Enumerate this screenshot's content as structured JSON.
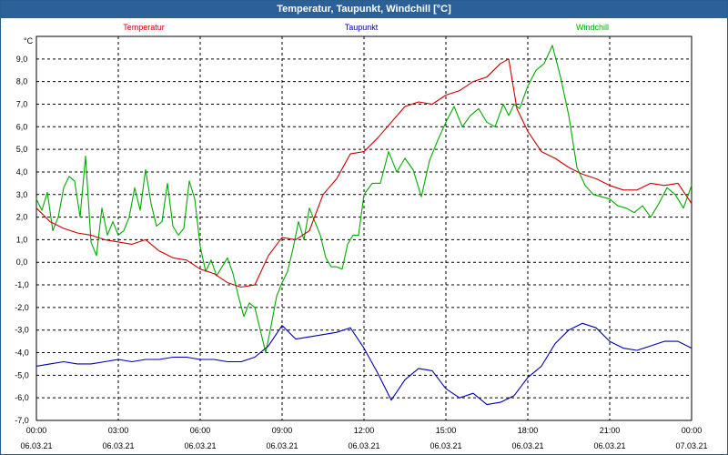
{
  "window": {
    "title": "Temperatur, Taupunkt, Windchill [°C]"
  },
  "colors": {
    "temperatur": "#cc0000",
    "taupunkt": "#0000aa",
    "windchill": "#00aa00",
    "grid": "#000000",
    "titlebar": "#2b6099"
  },
  "chart_data": {
    "type": "line",
    "title": "Temperatur, Taupunkt, Windchill [°C]",
    "ylabel": "°C",
    "xlabel": "",
    "ylim": [
      -7.0,
      10.0
    ],
    "xlim": [
      0,
      24
    ],
    "grid": true,
    "legend_placement": "top",
    "yticks": [
      "9,0",
      "8,0",
      "7,0",
      "6,0",
      "5,0",
      "4,0",
      "3,0",
      "2,0",
      "1,0",
      "0,0",
      "-1,0",
      "-2,0",
      "-3,0",
      "-4,0",
      "-5,0",
      "-6,0",
      "-7,0"
    ],
    "ytick_values": [
      9,
      8,
      7,
      6,
      5,
      4,
      3,
      2,
      1,
      0,
      -1,
      -2,
      -3,
      -4,
      -5,
      -6,
      -7
    ],
    "xticks": [
      {
        "time": "00:00",
        "date": "06.03.21"
      },
      {
        "time": "03:00",
        "date": "06.03.21"
      },
      {
        "time": "06:00",
        "date": "06.03.21"
      },
      {
        "time": "09:00",
        "date": "06.03.21"
      },
      {
        "time": "12:00",
        "date": "06.03.21"
      },
      {
        "time": "15:00",
        "date": "06.03.21"
      },
      {
        "time": "18:00",
        "date": "06.03.21"
      },
      {
        "time": "21:00",
        "date": "06.03.21"
      },
      {
        "time": "00:00",
        "date": "07.03.21"
      }
    ],
    "xtick_hours": [
      0,
      3,
      6,
      9,
      12,
      15,
      18,
      21,
      24
    ],
    "series": [
      {
        "name": "Temperatur",
        "color": "#cc0000",
        "x": [
          0,
          0.5,
          1,
          1.5,
          2,
          2.5,
          3,
          3.5,
          4,
          4.5,
          5,
          5.5,
          6,
          6.5,
          7,
          7.5,
          8,
          8.5,
          9,
          9.5,
          10,
          10.5,
          11,
          11.5,
          12,
          12.5,
          13,
          13.5,
          14,
          14.5,
          15,
          15.5,
          16,
          16.5,
          17,
          17.3,
          17.6,
          18,
          18.5,
          19,
          19.5,
          20,
          20.5,
          21,
          21.5,
          22,
          22.5,
          23,
          23.5,
          24
        ],
        "y": [
          2.4,
          1.8,
          1.5,
          1.3,
          1.2,
          1.0,
          0.9,
          0.8,
          1.0,
          0.5,
          0.2,
          0.1,
          -0.3,
          -0.5,
          -0.9,
          -1.1,
          -1.0,
          0.3,
          1.1,
          1.0,
          1.4,
          3.0,
          3.7,
          4.8,
          4.9,
          5.5,
          6.2,
          6.9,
          7.1,
          7.0,
          7.4,
          7.6,
          8.0,
          8.2,
          8.8,
          9.0,
          6.8,
          5.8,
          4.9,
          4.6,
          4.2,
          3.9,
          3.7,
          3.4,
          3.2,
          3.2,
          3.5,
          3.4,
          3.5,
          2.6
        ]
      },
      {
        "name": "Taupunkt",
        "color": "#0000aa",
        "x": [
          0,
          0.5,
          1,
          1.5,
          2,
          2.5,
          3,
          3.5,
          4,
          4.5,
          5,
          5.5,
          6,
          6.5,
          7,
          7.5,
          8,
          8.5,
          9,
          9.5,
          10,
          10.5,
          11,
          11.5,
          12,
          12.5,
          13,
          13.5,
          14,
          14.5,
          15,
          15.5,
          16,
          16.5,
          17,
          17.5,
          18,
          18.5,
          19,
          19.5,
          20,
          20.5,
          21,
          21.5,
          22,
          22.5,
          23,
          23.5,
          24
        ],
        "y": [
          -4.6,
          -4.5,
          -4.4,
          -4.5,
          -4.5,
          -4.4,
          -4.3,
          -4.4,
          -4.3,
          -4.3,
          -4.2,
          -4.2,
          -4.3,
          -4.3,
          -4.4,
          -4.4,
          -4.2,
          -3.7,
          -2.8,
          -3.4,
          -3.3,
          -3.2,
          -3.1,
          -2.9,
          -3.8,
          -4.9,
          -6.1,
          -5.2,
          -4.7,
          -4.8,
          -5.6,
          -6.0,
          -5.8,
          -6.3,
          -6.2,
          -5.9,
          -5.1,
          -4.6,
          -3.6,
          -3.0,
          -2.7,
          -2.9,
          -3.5,
          -3.8,
          -3.9,
          -3.7,
          -3.5,
          -3.5,
          -3.8
        ]
      },
      {
        "name": "Windchill",
        "color": "#00aa00",
        "x": [
          0,
          0.2,
          0.4,
          0.6,
          0.8,
          1.0,
          1.2,
          1.4,
          1.6,
          1.8,
          2.0,
          2.2,
          2.4,
          2.6,
          2.8,
          3.0,
          3.2,
          3.4,
          3.6,
          3.8,
          4.0,
          4.2,
          4.4,
          4.6,
          4.8,
          5.0,
          5.2,
          5.4,
          5.6,
          5.8,
          6.0,
          6.2,
          6.4,
          6.6,
          6.8,
          7.0,
          7.2,
          7.4,
          7.6,
          7.8,
          8.0,
          8.2,
          8.4,
          8.6,
          8.8,
          9.0,
          9.2,
          9.4,
          9.6,
          9.8,
          10.0,
          10.2,
          10.4,
          10.6,
          10.8,
          11.0,
          11.2,
          11.4,
          11.6,
          11.8,
          12.0,
          12.3,
          12.6,
          12.9,
          13.2,
          13.5,
          13.8,
          14.1,
          14.4,
          14.7,
          15.0,
          15.3,
          15.6,
          15.9,
          16.2,
          16.5,
          16.8,
          17.1,
          17.3,
          17.5,
          17.7,
          18.0,
          18.3,
          18.6,
          18.9,
          19.2,
          19.5,
          19.8,
          20.1,
          20.4,
          20.7,
          21.0,
          21.3,
          21.6,
          21.9,
          22.2,
          22.5,
          22.8,
          23.1,
          23.4,
          23.7,
          24.0
        ],
        "y": [
          2.8,
          2.3,
          3.1,
          1.4,
          2.0,
          3.3,
          3.8,
          3.6,
          2.0,
          4.7,
          0.9,
          0.3,
          2.4,
          1.2,
          1.8,
          1.2,
          1.4,
          2.0,
          3.3,
          2.3,
          4.1,
          2.6,
          1.6,
          1.8,
          3.5,
          1.6,
          1.2,
          1.5,
          3.6,
          2.8,
          0.7,
          -0.4,
          0.1,
          -0.6,
          -0.2,
          0.2,
          -0.5,
          -1.5,
          -2.4,
          -1.8,
          -2.0,
          -3.0,
          -4.0,
          -2.8,
          -1.5,
          -0.9,
          -0.4,
          0.6,
          1.8,
          1.0,
          2.4,
          1.8,
          1.2,
          0.2,
          -0.2,
          -0.2,
          -0.3,
          0.8,
          1.2,
          1.2,
          3.0,
          3.5,
          3.5,
          4.9,
          4.0,
          4.6,
          4.1,
          2.9,
          4.5,
          5.4,
          6.2,
          6.9,
          6.0,
          6.5,
          6.8,
          6.2,
          6.0,
          7.0,
          6.5,
          7.0,
          6.8,
          7.8,
          8.5,
          8.8,
          9.6,
          8.2,
          6.5,
          4.2,
          3.4,
          3.0,
          2.9,
          2.8,
          2.5,
          2.4,
          2.2,
          2.5,
          2.0,
          2.6,
          3.3,
          3.0,
          2.4,
          3.4
        ]
      }
    ]
  }
}
